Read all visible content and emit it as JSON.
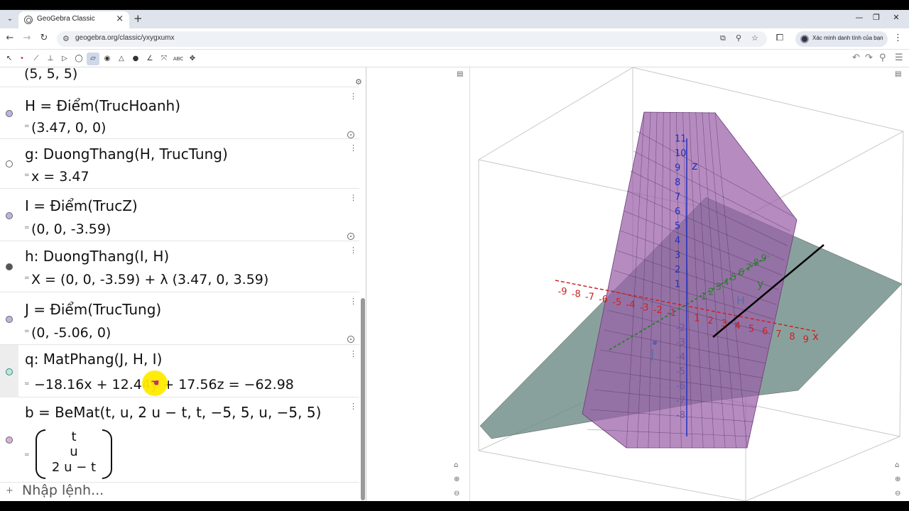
{
  "browser": {
    "tab_title": "GeoGebra Classic",
    "url": "geogebra.org/classic/yxygxumx",
    "profile_label": "Xác minh danh tính của bạn"
  },
  "algebra": {
    "partial_top_value": "(5, 5, 5)",
    "items": [
      {
        "def": "H = Điểm(TrucHoanh)",
        "value": "(3.47, 0, 0)",
        "marble": "#b9b6e6"
      },
      {
        "def": "g: DuongThang(H, TrucTung)",
        "value": "x = 3.47",
        "marble": "#ffffff"
      },
      {
        "def": "I = Điểm(TrucZ)",
        "value": "(0, 0, -3.59)",
        "marble": "#b9b6e6"
      },
      {
        "def": "h: DuongThang(I, H)",
        "value": "X = (0, 0, -3.59) + λ (3.47, 0, 3.59)",
        "marble": "#555555"
      },
      {
        "def": "J = Điểm(TrucTung)",
        "value": "(0, -5.06, 0)",
        "marble": "#b9b6e6"
      },
      {
        "def": "q: MatPhang(J, H, I)",
        "value": "−18.16x + 12.44y + 17.56z  =  −62.98",
        "marble": "#bfe6dd"
      },
      {
        "def": "b  =  BeMat(t, u, 2 u − t, t, −5, 5, u, −5, 5)",
        "matrix": [
          "t",
          "u",
          "2 u − t"
        ],
        "marble": "#d9b3d9"
      }
    ],
    "input_placeholder": "Nhập lệnh..."
  },
  "graphics3d": {
    "axis_labels": {
      "x": "x",
      "y": "y",
      "z": "z"
    },
    "point_labels": {
      "H": "H",
      "J": "J"
    },
    "x_ticks": [
      "-9",
      "-8",
      "-7",
      "-6",
      "-5",
      "-4",
      "-3",
      "-2",
      "-1",
      "1",
      "2",
      "3",
      "4",
      "5",
      "6",
      "7",
      "8",
      "9"
    ],
    "y_ticks": [
      "1",
      "2",
      "3",
      "4",
      "5",
      "6",
      "7",
      "8",
      "9"
    ],
    "z_ticks_pos": [
      "1",
      "2",
      "3",
      "4",
      "5",
      "6",
      "7",
      "8",
      "9",
      "10",
      "11"
    ],
    "z_ticks_neg": [
      "-2",
      "-3",
      "-4",
      "-5",
      "-6",
      "-7",
      "-8"
    ],
    "colors": {
      "plane_q": "#6b8a84",
      "surface_b": "#9a5fa8",
      "x_axis": "#cc2222",
      "y_axis": "#2e7d32",
      "z_axis": "#2030c0"
    }
  }
}
